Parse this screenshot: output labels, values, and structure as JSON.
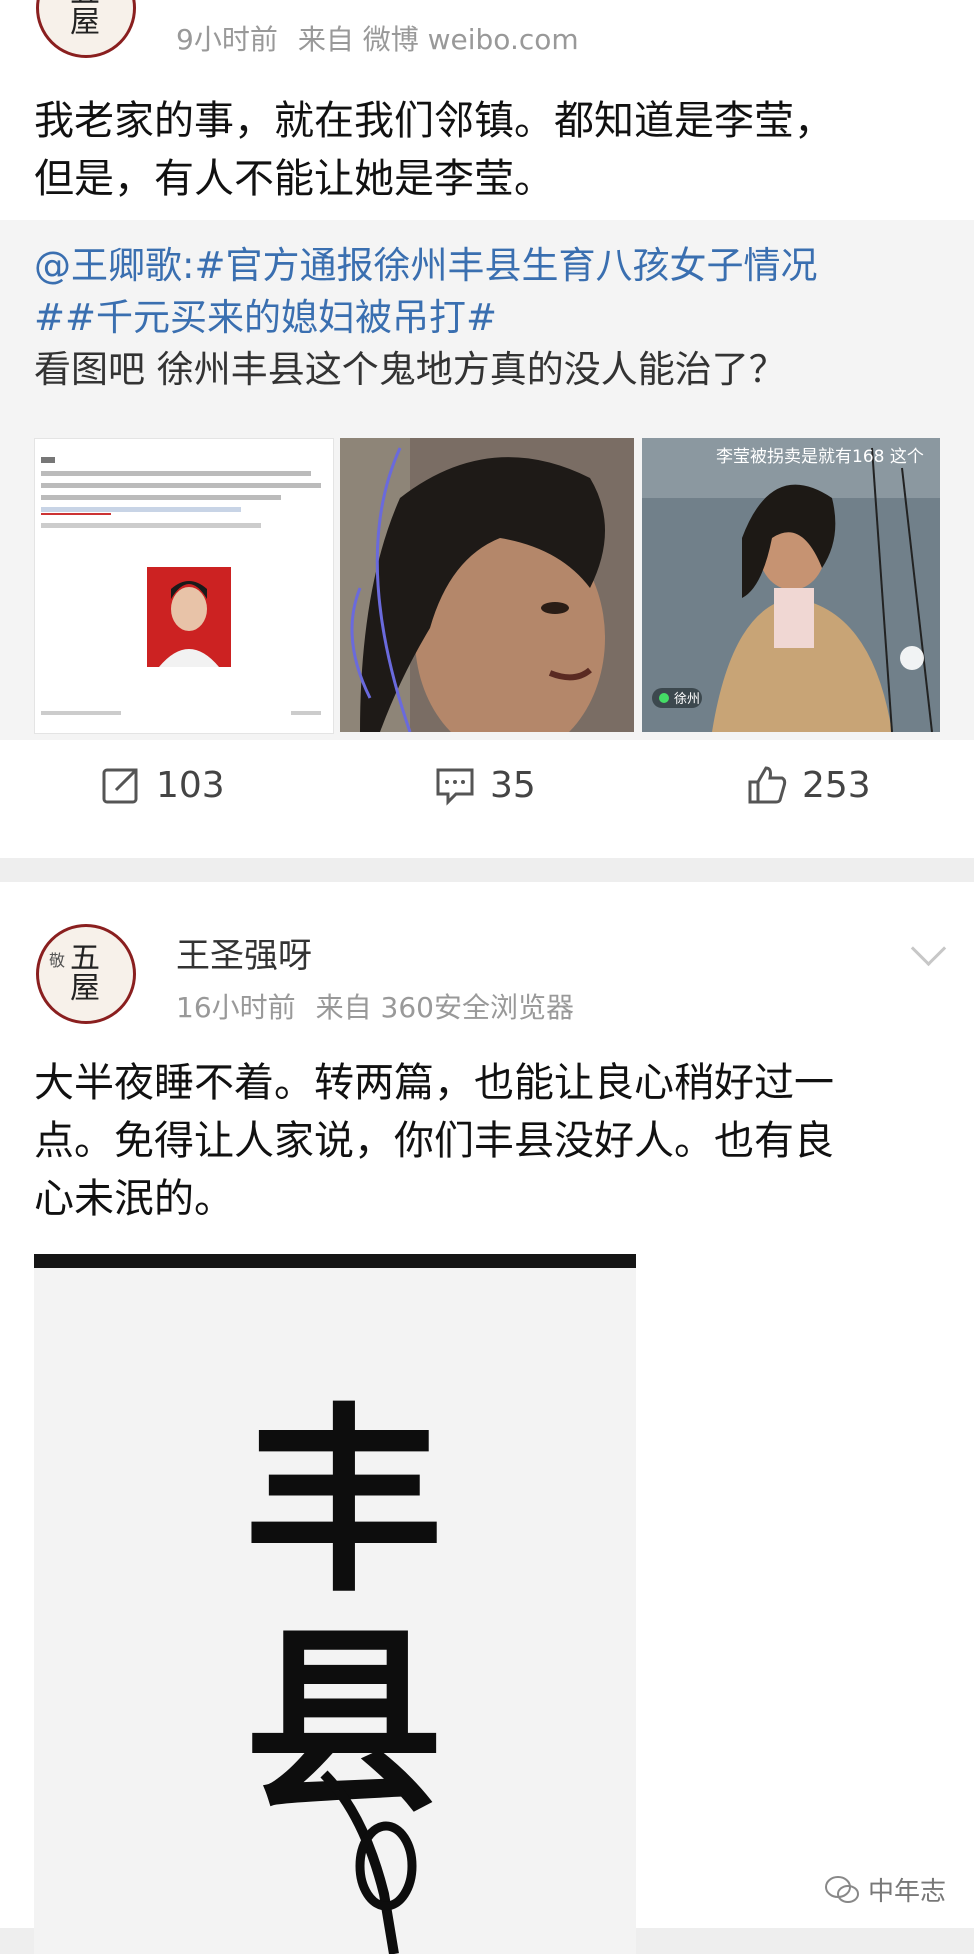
{
  "post1": {
    "meta_time": "9小时前",
    "meta_source": "来自 微博 weibo.com",
    "text_line1": "我老家的事，就在我们邻镇。都知道是李莹，",
    "text_line2": "但是，有人不能让她是李莹。",
    "repost": {
      "mention": "@王卿歌",
      "topic1": ":#官方通报徐州丰县生育八孩女子情况",
      "topic2": "##千元买来的媳妇被吊打#",
      "text": "看图吧 徐州丰县这个鬼地方真的没人能治了？",
      "thumb3_caption": "李莹被拐卖是就有168 这个",
      "thumb3_location": "徐州"
    },
    "actions": {
      "repost_count": "103",
      "comment_count": "35",
      "like_count": "253"
    }
  },
  "post2": {
    "username": "王圣强呀",
    "meta_time": "16小时前",
    "meta_source": "来自 360安全浏览器",
    "text_line1": "大半夜睡不着。转两篇，也能让良心稍好过一",
    "text_line2": "点。免得让人家说，你们丰县没好人。也有良",
    "text_line3": "心未泯的。",
    "graphic_char1": "丰",
    "graphic_char2": "县"
  },
  "avatar_seal": {
    "line1": "五",
    "line2": "屋",
    "side": "敬"
  },
  "watermark": "中年志",
  "colors": {
    "link": "#3a6fb0",
    "meta": "#999999",
    "divider": "#eeeeee"
  }
}
